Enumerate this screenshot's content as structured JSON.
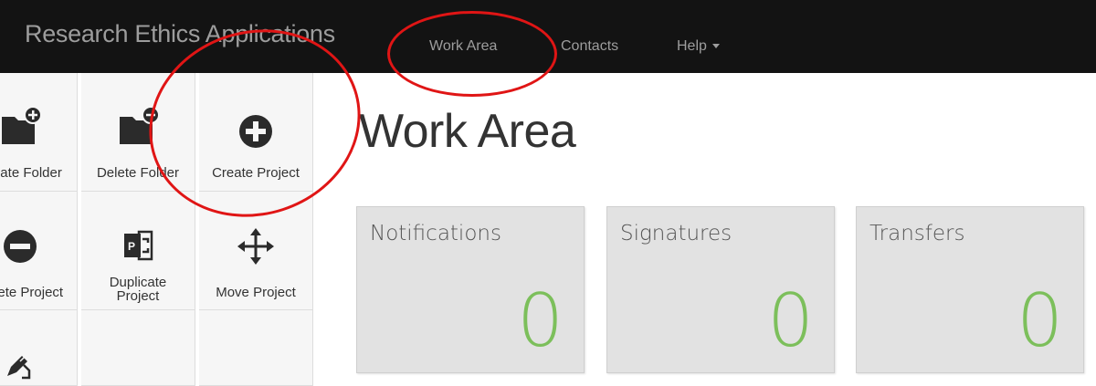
{
  "navbar": {
    "brand": "Research Ethics Applications",
    "items": [
      {
        "label": "Work Area"
      },
      {
        "label": "Contacts"
      },
      {
        "label": "Help"
      }
    ]
  },
  "toolbar": {
    "tools": [
      {
        "label": "Create Folder",
        "icon": "folder-plus-icon"
      },
      {
        "label": "Delete Folder",
        "icon": "folder-minus-icon"
      },
      {
        "label": "Create Project",
        "icon": "plus-circle-icon"
      },
      {
        "label": "Delete Project",
        "icon": "minus-circle-icon"
      },
      {
        "label": "Duplicate Project",
        "icon": "duplicate-project-icon"
      },
      {
        "label": "Move Project",
        "icon": "move-arrows-icon"
      },
      {
        "label": "",
        "icon": "edit-pencil-icon"
      }
    ]
  },
  "main": {
    "title": "Work Area",
    "tiles": [
      {
        "title": "Notifications",
        "count": "0"
      },
      {
        "title": "Signatures",
        "count": "0"
      },
      {
        "title": "Transfers",
        "count": "0"
      }
    ]
  },
  "colors": {
    "navbar_bg": "#131313",
    "nav_text": "#9d9d9d",
    "tile_bg": "#e2e2e2",
    "count_green": "#7cbf5b",
    "annotation_red": "#e01515"
  }
}
